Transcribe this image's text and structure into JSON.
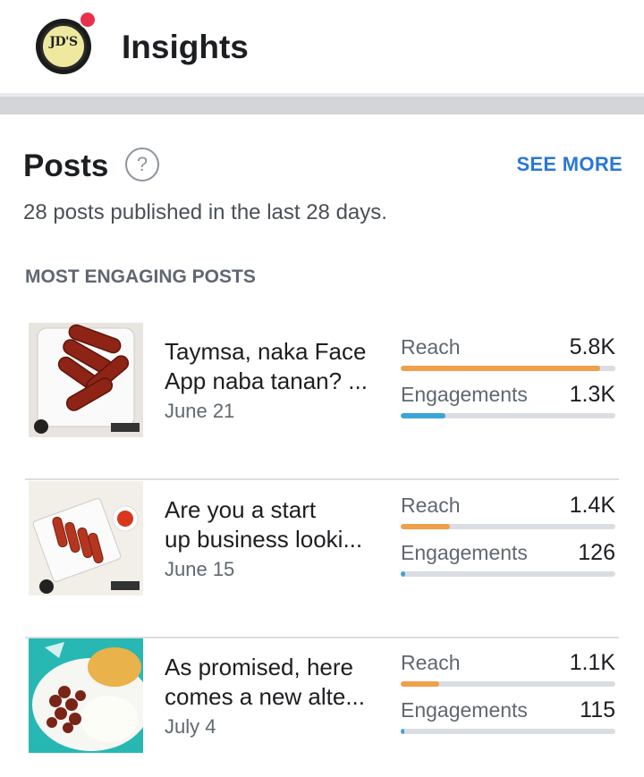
{
  "header": {
    "title": "Insights",
    "avatar_text": "JD'S",
    "avatar_badge_color": "#e8304a"
  },
  "posts_card": {
    "title": "Posts",
    "help_icon": "?",
    "see_more_label": "SEE MORE",
    "subtitle": "28 posts published in the last 28 days.",
    "section_label": "MOST ENGAGING POSTS"
  },
  "colors": {
    "reach_bar": "#f0a04b",
    "engagement_bar": "#3da4d9",
    "link": "#2a77d6"
  },
  "posts": [
    {
      "line1": "Taymsa, naka Face",
      "line2": "App naba tanan? ...",
      "date": "June 21",
      "reach_label": "Reach",
      "reach_value": "5.8K",
      "reach_fraction": 0.93,
      "engagement_label": "Engagements",
      "engagement_value": "1.3K",
      "engagement_fraction": 0.21
    },
    {
      "line1": "Are you a start",
      "line2": "up business looki...",
      "date": "June 15",
      "reach_label": "Reach",
      "reach_value": "1.4K",
      "reach_fraction": 0.23,
      "engagement_label": "Engagements",
      "engagement_value": "126",
      "engagement_fraction": 0.02
    },
    {
      "line1": "As promised, here",
      "line2": "comes a new alte...",
      "date": "July 4",
      "reach_label": "Reach",
      "reach_value": "1.1K",
      "reach_fraction": 0.18,
      "engagement_label": "Engagements",
      "engagement_value": "115",
      "engagement_fraction": 0.015
    }
  ]
}
